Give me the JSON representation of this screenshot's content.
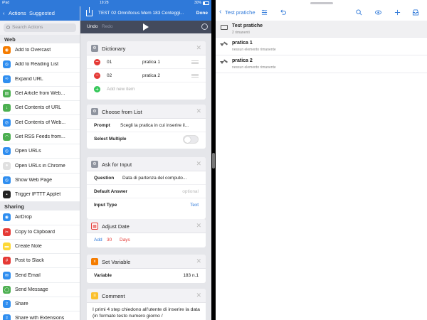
{
  "status_bar": {
    "carrier": "iPad",
    "time": "19:28",
    "battery": "30%"
  },
  "actions_panel": {
    "back_label": "‹",
    "title": "Actions",
    "tab": "Suggested",
    "search_placeholder": "Search Actions",
    "sections": [
      {
        "title": "Web",
        "items": [
          {
            "label": "Add to Overcast",
            "icon": "overcast-icon",
            "color": "#f57c00"
          },
          {
            "label": "Add to Reading List",
            "icon": "safari-icon",
            "color": "#2f8ef0"
          },
          {
            "label": "Expand URL",
            "icon": "link-icon",
            "color": "#2f8ef0"
          },
          {
            "label": "Get Article from Web...",
            "icon": "article-icon",
            "color": "#4caf50"
          },
          {
            "label": "Get Contents of URL",
            "icon": "download-icon",
            "color": "#4caf50"
          },
          {
            "label": "Get Contents of Web...",
            "icon": "safari-icon",
            "color": "#2f8ef0"
          },
          {
            "label": "Get RSS Feeds from...",
            "icon": "rss-icon",
            "color": "#4caf50"
          },
          {
            "label": "Open URLs",
            "icon": "safari-icon",
            "color": "#2f8ef0"
          },
          {
            "label": "Open URLs in Chrome",
            "icon": "chrome-icon",
            "color": "#e0e0e0"
          },
          {
            "label": "Show Web Page",
            "icon": "safari-icon",
            "color": "#2f8ef0"
          },
          {
            "label": "Trigger IFTTT Applet",
            "icon": "ifttt-icon",
            "color": "#222222"
          }
        ]
      },
      {
        "title": "Sharing",
        "items": [
          {
            "label": "AirDrop",
            "icon": "airdrop-icon",
            "color": "#2f8ef0"
          },
          {
            "label": "Copy to Clipboard",
            "icon": "scissors-icon",
            "color": "#e53935"
          },
          {
            "label": "Create Note",
            "icon": "note-icon",
            "color": "#fdd835"
          },
          {
            "label": "Post to Slack",
            "icon": "slack-icon",
            "color": "#e53935"
          },
          {
            "label": "Send Email",
            "icon": "mail-icon",
            "color": "#2f8ef0"
          },
          {
            "label": "Send Message",
            "icon": "message-icon",
            "color": "#4caf50"
          },
          {
            "label": "Share",
            "icon": "share-icon",
            "color": "#2f8ef0"
          },
          {
            "label": "Share with Extensions",
            "icon": "share-icon",
            "color": "#2f8ef0"
          }
        ]
      }
    ]
  },
  "workflow": {
    "title": "TEST 02 Omnifocus Mem 183 Conteggi...",
    "done_label": "Done",
    "undo_label": "Undo",
    "redo_label": "Redo",
    "dictionary": {
      "title": "Dictionary",
      "rows": [
        {
          "key": "01",
          "value": "pratica 1"
        },
        {
          "key": "02",
          "value": "pratica 2"
        }
      ],
      "add_label": "Add new item"
    },
    "choose_from_list": {
      "title": "Choose from List",
      "prompt_label": "Prompt",
      "prompt_value": "Scegli la pratica in cui inserire il...",
      "multiple_label": "Select Multiple"
    },
    "ask_for_input": {
      "title": "Ask for Input",
      "question_label": "Question",
      "question_value": "Data di partenza del computo...",
      "default_label": "Default Answer",
      "default_value": "optional",
      "type_label": "Input Type",
      "type_value": "Text"
    },
    "adjust_date": {
      "title": "Adjust Date",
      "op": "Add",
      "amount": "30",
      "unit": "Days"
    },
    "set_variable": {
      "title": "Set Variable",
      "var_label": "Variable",
      "var_value": "183 n.1"
    },
    "comment": {
      "title": "Comment",
      "text": "I primi 4 step chiedono all'utente di inserire la data (in formato testo numero giorno /"
    }
  },
  "omnifocus": {
    "back_label": "‹",
    "title": "Test pratiche",
    "rows": [
      {
        "type": "project",
        "title": "Test pratiche",
        "subtitle": "2 rimanenti"
      },
      {
        "type": "task",
        "title": "pratica 1",
        "subtitle": "nessun elemento rimanente"
      },
      {
        "type": "task",
        "title": "pratica 2",
        "subtitle": "nessun elemento rimanente"
      }
    ]
  },
  "colors": {
    "accent": "#2f79d9",
    "toolbar": "#434a5c"
  }
}
